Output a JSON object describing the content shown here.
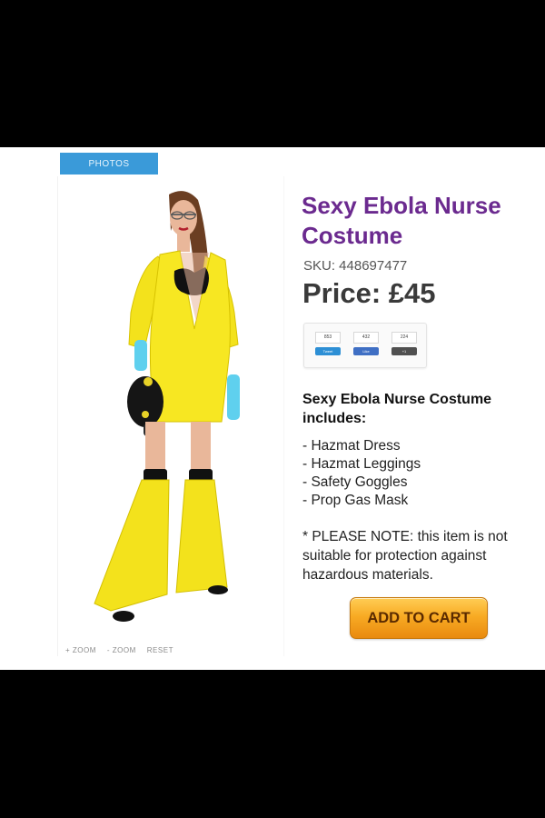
{
  "gallery": {
    "tab_label": "PHOTOS",
    "zoom_in": "+ ZOOM",
    "zoom_out": "- ZOOM",
    "reset": "RESET"
  },
  "product": {
    "title": "Sexy Ebola Nurse Costume",
    "sku": "SKU: 448697477",
    "price": "Price:  £45"
  },
  "social": {
    "widgets": [
      {
        "icon": "twitter-icon",
        "count": "853",
        "button": "Tweet",
        "color": "#2d8fd5"
      },
      {
        "icon": "facebook-icon",
        "count": "432",
        "button": "Like",
        "color": "#3f6fc4"
      },
      {
        "icon": "google-plus-icon",
        "count": "224",
        "button": "+1",
        "color": "#505050"
      }
    ]
  },
  "includes": {
    "heading": "Sexy Ebola Nurse Costume includes:",
    "items": [
      "- Hazmat Dress",
      "- Hazmat Leggings",
      "- Safety Goggles",
      "- Prop Gas Mask"
    ]
  },
  "note": "* PLEASE NOTE: this item is not suitable for protection against hazardous materials.",
  "cart": {
    "label": "ADD TO CART"
  },
  "colors": {
    "title": "#6b2a8f",
    "tab": "#3a9ad9",
    "button": "#f8ab24"
  }
}
